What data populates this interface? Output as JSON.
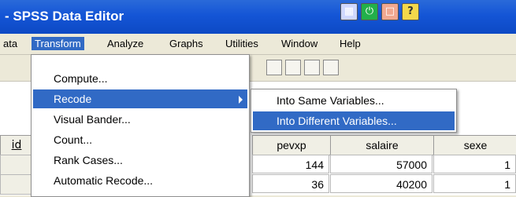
{
  "window": {
    "title": "- SPSS Data Editor"
  },
  "taskbar_icons": [
    "database-icon",
    "green-power-icon",
    "salmon-icon",
    "help-icon"
  ],
  "menubar": {
    "items": [
      {
        "label": "ata"
      },
      {
        "label": "Transform"
      },
      {
        "label": "Analyze"
      },
      {
        "label": "Graphs"
      },
      {
        "label": "Utilities"
      },
      {
        "label": "Window"
      },
      {
        "label": "Help"
      }
    ]
  },
  "transform_menu": {
    "items": [
      "Compute...",
      "Recode",
      "Visual Bander...",
      "Count...",
      "Rank Cases...",
      "Automatic Recode..."
    ]
  },
  "recode_submenu": {
    "items": [
      "Into Same Variables...",
      "Into Different Variables..."
    ]
  },
  "grid": {
    "id_label": "id",
    "columns": [
      "pevxp",
      "salaire",
      "sexe"
    ],
    "rows": [
      [
        "144",
        "57000",
        "1"
      ],
      [
        "36",
        "40200",
        "1"
      ]
    ]
  },
  "colors": {
    "menu_highlight": "#316ac5",
    "titlebar": "#1455d6"
  }
}
